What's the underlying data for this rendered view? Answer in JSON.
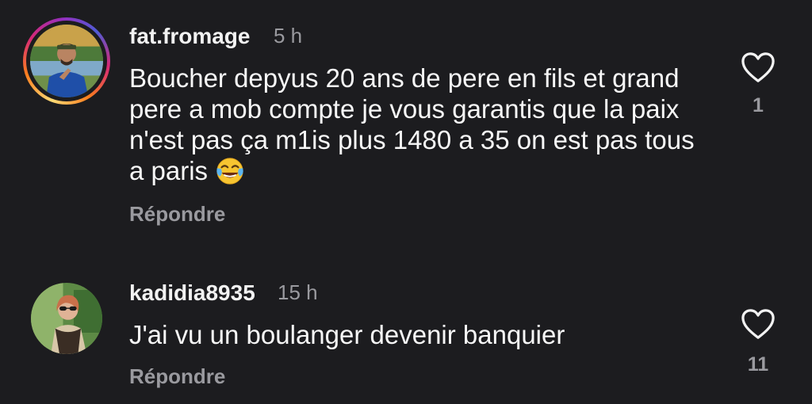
{
  "comments": [
    {
      "username": "fat.fromage",
      "time": "5 h",
      "text": "Boucher depyus 20 ans de pere en fils et grand pere a mob compte je vous garantis que la paix n'est pas ça m1is plus 1480 a 35 on est pas tous a paris",
      "emoji": "face-with-tears-of-joy",
      "reply_label": "Répondre",
      "like_icon": "heart-outline-icon",
      "likes": "1"
    },
    {
      "username": "kadidia8935",
      "time": "15 h",
      "text": "J'ai vu un boulanger devenir banquier",
      "reply_label": "Répondre",
      "like_icon": "heart-outline-icon",
      "likes": "11"
    }
  ],
  "colors": {
    "background": "#1c1c1f",
    "primary_text": "#f7f7f7",
    "secondary_text": "#9a9a9f"
  }
}
